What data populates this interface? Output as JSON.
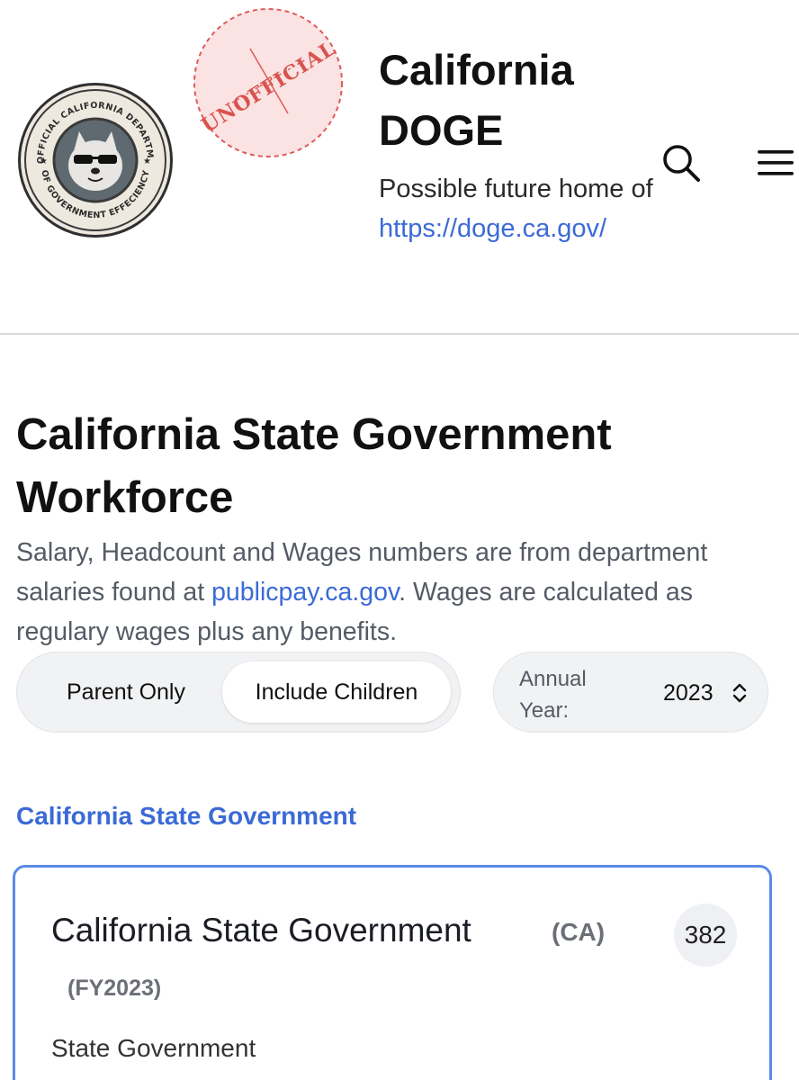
{
  "header": {
    "site_title": "California DOGE",
    "tagline": "Possible future home of",
    "tagline_link": "https://doge.ca.gov/",
    "logo_text_top": "UNOFFICIAL CALIFORNIA DEPARTMENT",
    "logo_text_bottom": "OF GOVERNMENT EFFECIENCY",
    "stamp_text": "UNOFFICIAL",
    "search_icon": "search-icon",
    "menu_icon": "hamburger-menu-icon"
  },
  "page": {
    "title": "California State Government Workforce",
    "description_before_link": "Salary, Headcount and Wages numbers are from department salaries found at ",
    "description_link": "publicpay.ca.gov",
    "description_after_link": ". Wages are calculated as regulary wages plus any benefits."
  },
  "filters": {
    "segment_options": [
      "Parent Only",
      "Include Children"
    ],
    "segment_selected": "Include Children",
    "year_label": "Annual Year:",
    "year_value": "2023"
  },
  "breadcrumb": {
    "label": "California State Government"
  },
  "card": {
    "name": "California State Government",
    "code": "(CA)",
    "fiscal_year": "(FY2023)",
    "count_badge": "382",
    "type": "State Government",
    "border_color": "#5a8ae6"
  },
  "colors": {
    "link": "#3b6ad6",
    "muted_text": "#555b66",
    "stamp_red": "#e05a5a"
  }
}
